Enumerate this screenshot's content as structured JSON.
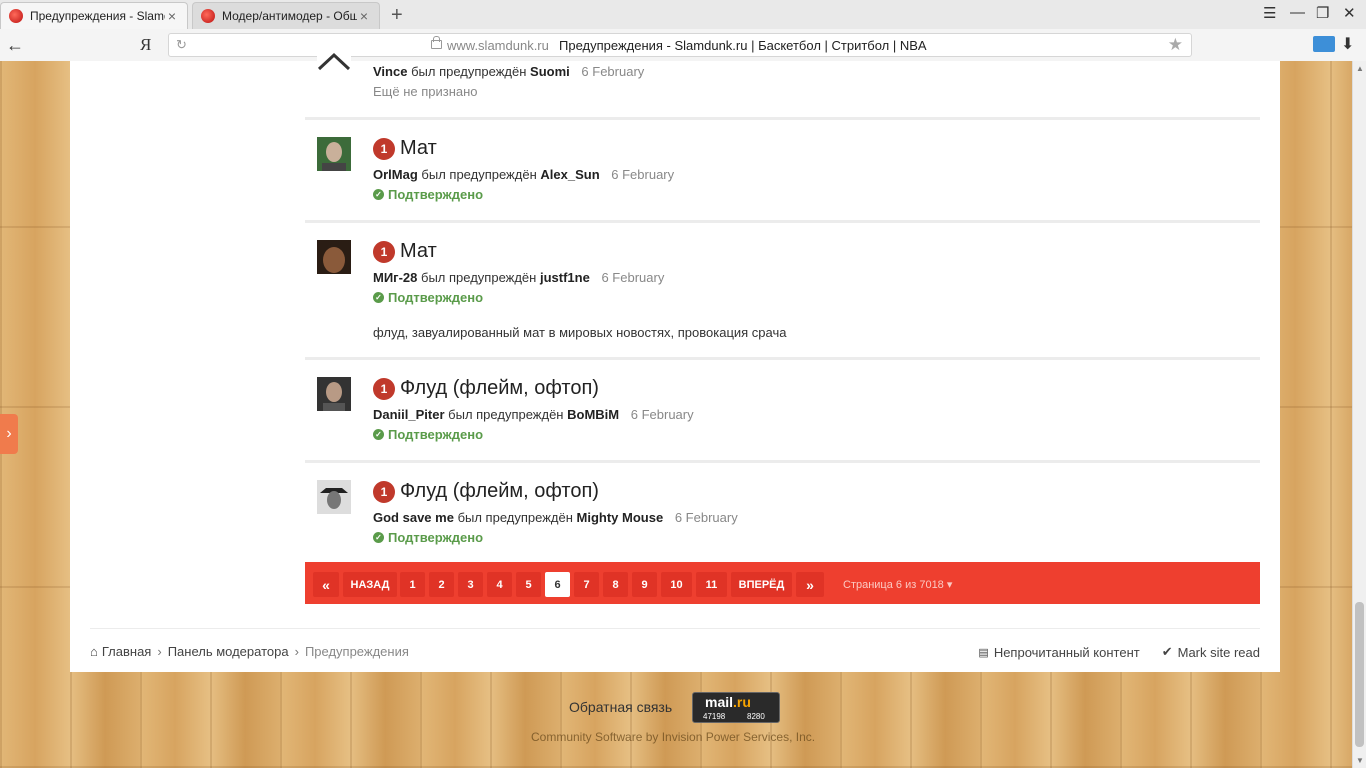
{
  "browser": {
    "tabs": [
      {
        "label": "Предупреждения - Slamdunk.ru",
        "close": "×"
      },
      {
        "label": "Модер/антимодер - Общий",
        "close": "×"
      }
    ],
    "new_tab": "+",
    "yandex_logo": "Я",
    "url_host": "www.slamdunk.ru",
    "url_title": "Предупреждения - Slamdunk.ru | Баскетбол | Стритбол | NBA",
    "window_controls": [
      "☰",
      "—",
      "❐",
      "✕"
    ]
  },
  "warnings": [
    {
      "user": "Vince",
      "action": "был предупреждён",
      "target": "Suomi",
      "date": "6 February",
      "status": "Ещё не признано",
      "status_type": "pending"
    },
    {
      "points": "1",
      "title": "Мат",
      "user": "OrlMag",
      "action": "был предупреждён",
      "target": "Alex_Sun",
      "date": "6 February",
      "status": "Подтверждено",
      "status_type": "confirmed"
    },
    {
      "points": "1",
      "title": "Мат",
      "user": "МИг-28",
      "action": "был предупреждён",
      "target": "justf1ne",
      "date": "6 February",
      "status": "Подтверждено",
      "status_type": "confirmed",
      "note": "флуд, завуалированный мат в мировых новостях, провокация срача"
    },
    {
      "points": "1",
      "title": "Флуд (флейм, офтоп)",
      "user": "Daniil_Piter",
      "action": "был предупреждён",
      "target": "BoMBiM",
      "date": "6 February",
      "status": "Подтверждено",
      "status_type": "confirmed"
    },
    {
      "points": "1",
      "title": "Флуд (флейм, офтоп)",
      "user": "God save me",
      "action": "был предупреждён",
      "target": "Mighty Mouse",
      "date": "6 February",
      "status": "Подтверждено",
      "status_type": "confirmed"
    }
  ],
  "pagination": {
    "first": "«",
    "prev": "НАЗАД",
    "pages": [
      "1",
      "2",
      "3",
      "4",
      "5",
      "6",
      "7",
      "8",
      "9",
      "10",
      "11"
    ],
    "current": "6",
    "next": "ВПЕРЁД",
    "last": "»",
    "info": "Страница 6 из 7018"
  },
  "breadcrumb": {
    "home": "Главная",
    "mod_panel": "Панель модератора",
    "current": "Предупреждения"
  },
  "footer_actions": {
    "unread": "Непрочитанный контент",
    "mark_read": "Mark site read"
  },
  "footer": {
    "feedback": "Обратная связь",
    "counter_logo": "mail",
    "counter_logo_tld": ".ru",
    "counter_1": "47198",
    "counter_2": "8280",
    "copyright": "Community Software by Invision Power Services, Inc."
  },
  "colors": {
    "pager_bg": "#ee3f2f",
    "badge": "#c0392b",
    "confirmed": "#5a9b4a"
  }
}
